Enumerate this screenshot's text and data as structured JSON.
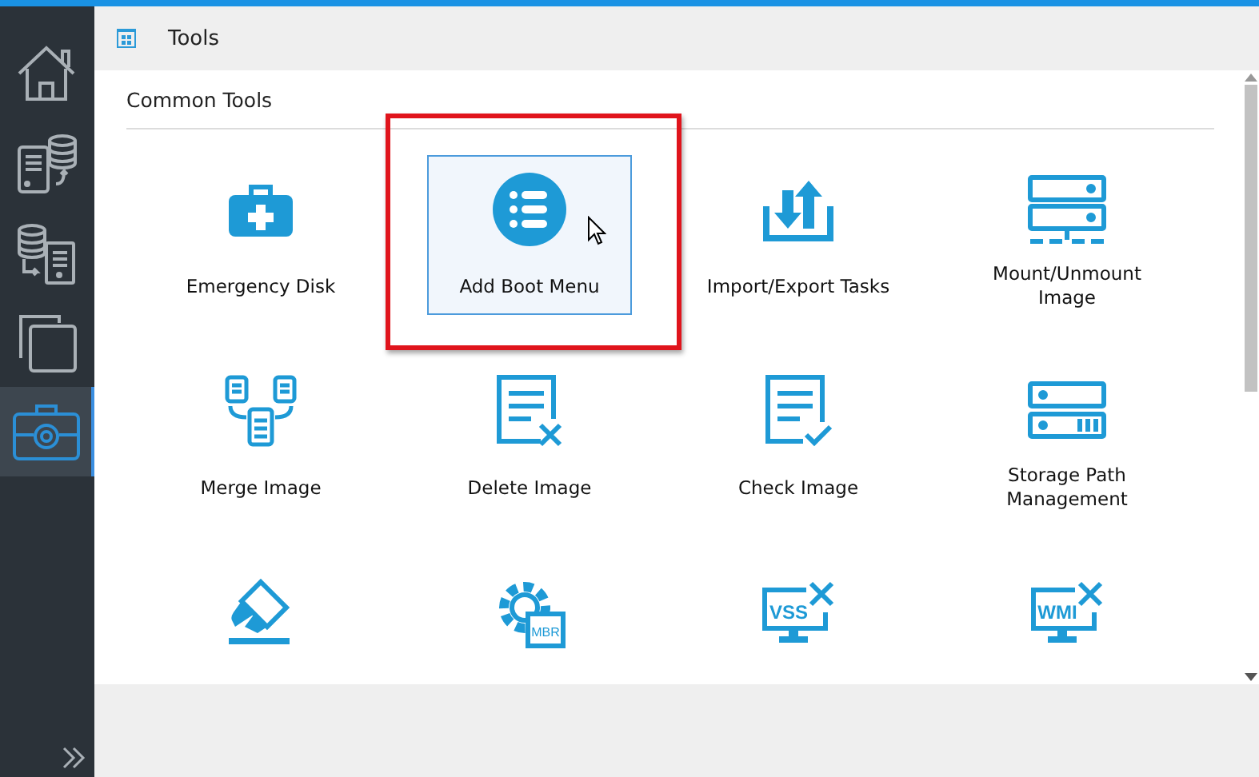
{
  "sidebar": {
    "items": [
      {
        "kind": "home",
        "selected": false
      },
      {
        "kind": "backup",
        "selected": false
      },
      {
        "kind": "restore",
        "selected": false
      },
      {
        "kind": "clone",
        "selected": false
      },
      {
        "kind": "tools",
        "selected": true
      }
    ]
  },
  "header": {
    "title": "Tools"
  },
  "section": {
    "title": "Common Tools",
    "tools": [
      {
        "kind": "medkit",
        "label": "Emergency Disk",
        "selected": false
      },
      {
        "kind": "list-circle",
        "label": "Add Boot Menu",
        "selected": true
      },
      {
        "kind": "import-export",
        "label": "Import/Export Tasks",
        "selected": false
      },
      {
        "kind": "server-mount",
        "label": "Mount/Unmount\nImage",
        "selected": false
      },
      {
        "kind": "merge",
        "label": "Merge Image",
        "selected": false
      },
      {
        "kind": "delete-doc",
        "label": "Delete Image",
        "selected": false
      },
      {
        "kind": "check-doc",
        "label": "Check Image",
        "selected": false
      },
      {
        "kind": "storage",
        "label": "Storage Path\nManagement",
        "selected": false
      },
      {
        "kind": "eraser",
        "selected": false
      },
      {
        "kind": "gear-badge",
        "icon_text": "MBR",
        "selected": false
      },
      {
        "kind": "monitor-tools",
        "icon_text": "VSS",
        "selected": false
      },
      {
        "kind": "monitor-tools",
        "icon_text": "WMI",
        "selected": false
      }
    ]
  }
}
